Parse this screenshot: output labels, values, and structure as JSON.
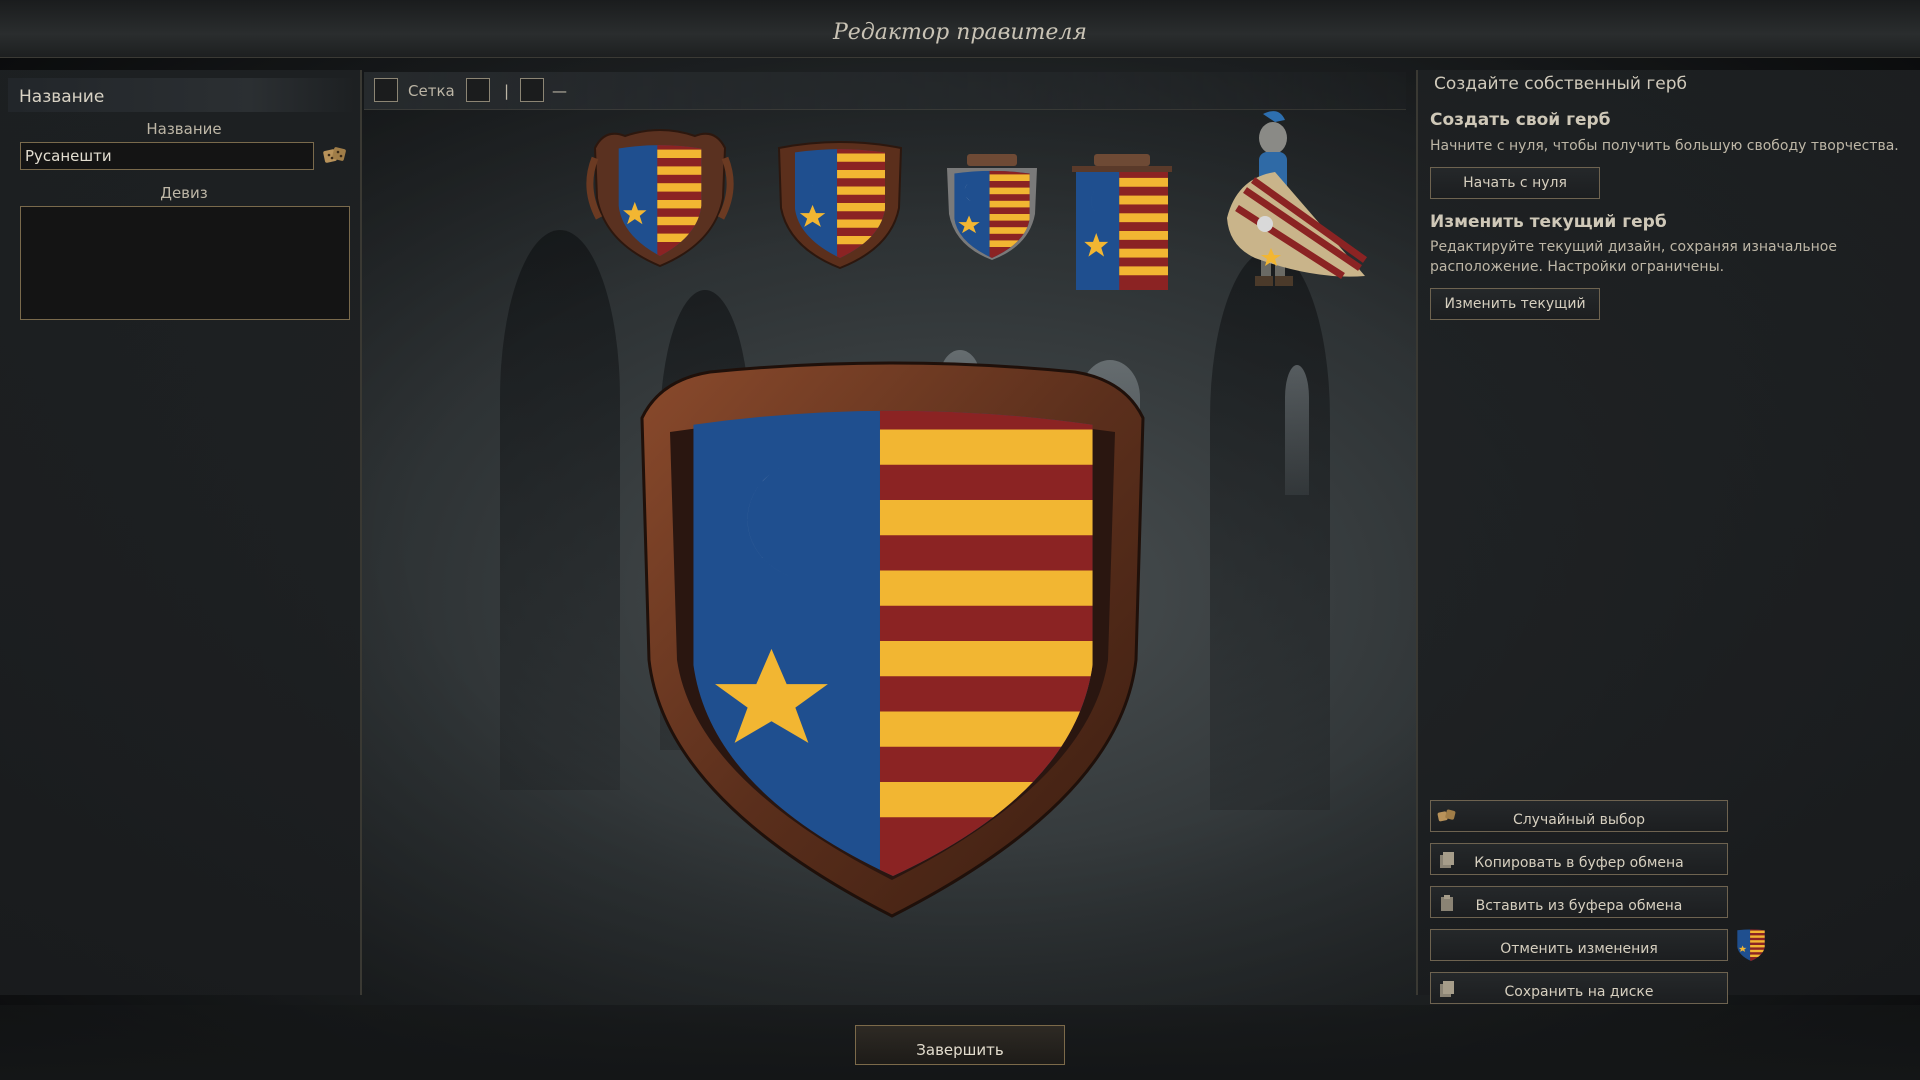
{
  "title": "Редактор правителя",
  "left_panel": {
    "header": "Название",
    "name_label": "Название",
    "name_value": "Русанешти",
    "motto_label": "Девиз",
    "motto_value": ""
  },
  "toolbar": {
    "grid_label": "Сетка",
    "vertical_symbol": "|",
    "horizontal_symbol": "—"
  },
  "colors": {
    "field_blue": "#1f4f8f",
    "stripe_gold": "#f2b632",
    "stripe_red": "#8b2323",
    "crescent_silver": "#d9d9d9",
    "star_gold": "#f2b632",
    "frame_bronze": "#6b3a22"
  },
  "right_panel": {
    "header": "Создайте собственный герб",
    "create": {
      "title": "Создать свой герб",
      "desc": "Начните с нуля, чтобы получить большую свободу творчества.",
      "button": "Начать с нуля"
    },
    "edit": {
      "title": "Изменить текущий герб",
      "desc": "Редактируйте текущий дизайн, сохраняя изначальное расположение. Настройки ограничены.",
      "button": "Изменить текущий"
    },
    "actions": [
      {
        "label": "Случайный выбор",
        "icon": "dice-icon"
      },
      {
        "label": "Копировать в буфер обмена",
        "icon": "clipboard-copy-icon"
      },
      {
        "label": "Вставить из буфера обмена",
        "icon": "clipboard-paste-icon"
      },
      {
        "label": "Отменить изменения",
        "icon": "none"
      },
      {
        "label": "Сохранить на диске",
        "icon": "save-icon"
      }
    ]
  },
  "finish_button": "Завершить"
}
